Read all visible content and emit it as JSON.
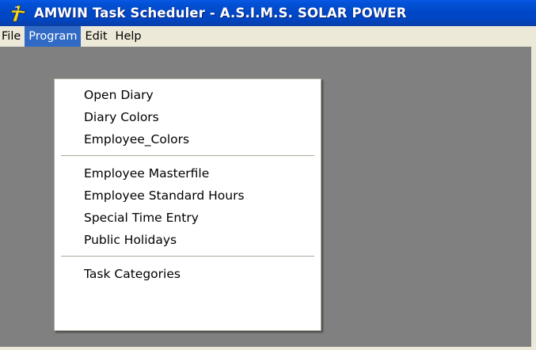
{
  "window": {
    "title": "AMWIN Task Scheduler - A.S.I.M.S. SOLAR POWER",
    "icon": "amwin-app-icon"
  },
  "menubar": {
    "items": [
      {
        "label": "File"
      },
      {
        "label": "Program",
        "active": true
      },
      {
        "label": "Edit"
      },
      {
        "label": "Help"
      }
    ]
  },
  "program_menu": {
    "groups": [
      [
        "Open Diary",
        "Diary Colors",
        "Employee_Colors"
      ],
      [
        "Employee Masterfile",
        "Employee Standard Hours",
        "Special Time Entry",
        "Public Holidays"
      ],
      [
        "Task Categories"
      ]
    ]
  },
  "colors": {
    "titlebar": "#0048c8",
    "menu_highlight": "#316ac5",
    "client_background": "#808080"
  }
}
